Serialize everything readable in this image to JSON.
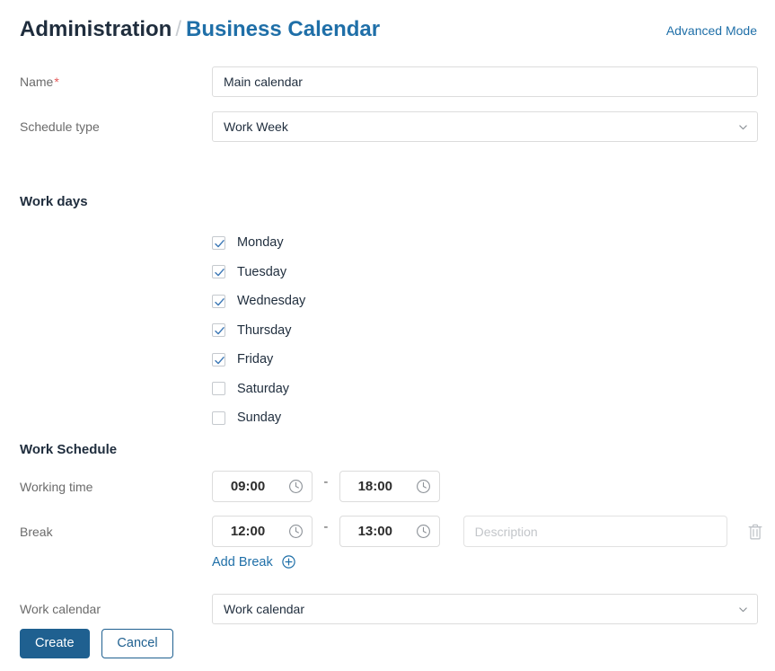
{
  "header": {
    "breadcrumb_root": "Administration",
    "breadcrumb_separator": "/",
    "breadcrumb_current": "Business Calendar",
    "advanced_mode_label": "Advanced Mode",
    "accent_color": "#1f6fa8"
  },
  "form": {
    "name": {
      "label": "Name",
      "required_marker": "*",
      "value": "Main calendar",
      "placeholder": ""
    },
    "schedule_type": {
      "label": "Schedule type",
      "value": "Work Week"
    },
    "work_days": {
      "heading": "Work days",
      "days": [
        {
          "label": "Monday",
          "checked": true
        },
        {
          "label": "Tuesday",
          "checked": true
        },
        {
          "label": "Wednesday",
          "checked": true
        },
        {
          "label": "Thursday",
          "checked": true
        },
        {
          "label": "Friday",
          "checked": true
        },
        {
          "label": "Saturday",
          "checked": false
        },
        {
          "label": "Sunday",
          "checked": false
        }
      ]
    },
    "work_schedule": {
      "heading": "Work Schedule",
      "working_time": {
        "label": "Working time",
        "start": "09:00",
        "end": "18:00",
        "range_separator": "-"
      },
      "break": {
        "label": "Break",
        "start": "12:00",
        "end": "13:00",
        "range_separator": "-",
        "description_value": "",
        "description_placeholder": "Description"
      },
      "add_break_label": "Add Break"
    },
    "work_calendar": {
      "label": "Work calendar",
      "value": "Work calendar"
    }
  },
  "actions": {
    "create_label": "Create",
    "cancel_label": "Cancel",
    "primary_color": "#1f6090"
  }
}
